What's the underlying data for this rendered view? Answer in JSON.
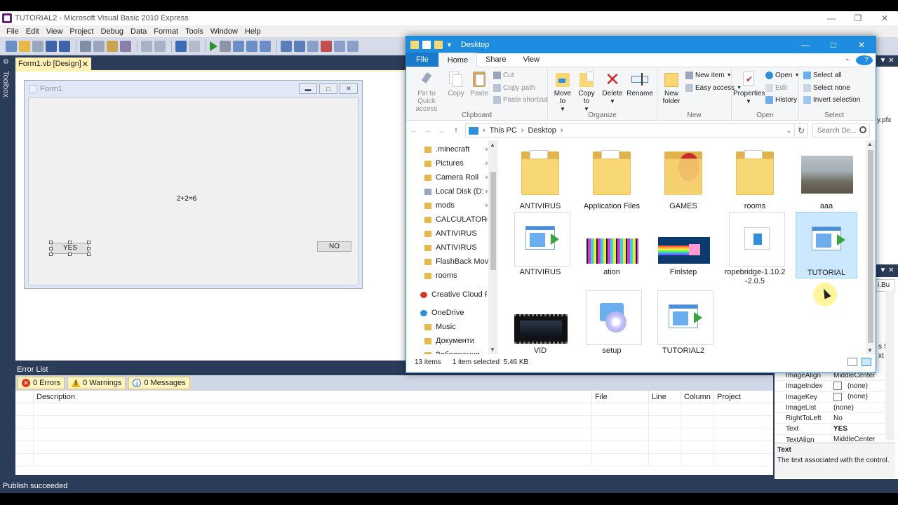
{
  "vs": {
    "title": "TUTORIAL2 - Microsoft Visual Basic 2010 Express",
    "menu": [
      "File",
      "Edit",
      "View",
      "Project",
      "Debug",
      "Data",
      "Format",
      "Tools",
      "Window",
      "Help"
    ],
    "toolbox_label": "Toolbox",
    "doc_tab": "Form1.vb [Design]",
    "form": {
      "title": "Form1",
      "label_text": "2+2=6",
      "yes_button": "YES",
      "no_button": "NO"
    },
    "error_list": {
      "title": "Error List",
      "errors": "0 Errors",
      "warnings": "0 Warnings",
      "messages": "0 Messages",
      "columns": [
        "Description",
        "File",
        "Line",
        "Column",
        "Project"
      ]
    },
    "status": "Publish succeeded",
    "right_panel": {
      "pfx_fragment": "y.pfx",
      "props_dropdown": "i.Bu",
      "stub_lines": [
        "s S",
        "xt"
      ],
      "properties": [
        {
          "key": "ImageAlign",
          "value": "MiddleCenter",
          "box": false,
          "bold": false
        },
        {
          "key": "ImageIndex",
          "value": "(none)",
          "box": true,
          "bold": false
        },
        {
          "key": "ImageKey",
          "value": "(none)",
          "box": true,
          "bold": false
        },
        {
          "key": "ImageList",
          "value": "(none)",
          "box": false,
          "bold": false
        },
        {
          "key": "RightToLeft",
          "value": "No",
          "box": false,
          "bold": false
        },
        {
          "key": "Text",
          "value": "YES",
          "box": false,
          "bold": true
        },
        {
          "key": "TextAlign",
          "value": "MiddleCenter",
          "box": false,
          "bold": false
        }
      ],
      "desc_title": "Text",
      "desc_text": "The text associated with the control."
    }
  },
  "explorer": {
    "title": "Desktop",
    "tabs": [
      "File",
      "Home",
      "Share",
      "View"
    ],
    "ribbon": {
      "clipboard": {
        "name": "Clipboard",
        "pin": "Pin to Quick access",
        "copy": "Copy",
        "paste": "Paste",
        "cut": "Cut",
        "copy_path": "Copy path",
        "paste_shortcut": "Paste shortcut"
      },
      "organize": {
        "name": "Organize",
        "move_to": "Move to",
        "copy_to": "Copy to",
        "delete": "Delete",
        "rename": "Rename"
      },
      "new": {
        "name": "New",
        "new_folder": "New folder",
        "new_item": "New item",
        "easy_access": "Easy access"
      },
      "open": {
        "name": "Open",
        "properties": "Properties",
        "open": "Open",
        "edit": "Edit",
        "history": "History"
      },
      "select": {
        "name": "Select",
        "select_all": "Select all",
        "select_none": "Select none",
        "invert": "Invert selection"
      }
    },
    "address": [
      "This PC",
      "Desktop"
    ],
    "search_placeholder": "Search De...",
    "nav": [
      {
        "label": ".minecraft",
        "pinned": true
      },
      {
        "label": "Pictures",
        "pinned": true
      },
      {
        "label": "Camera Roll",
        "pinned": true
      },
      {
        "label": "Local Disk (D:",
        "pinned": true
      },
      {
        "label": "mods",
        "pinned": true
      },
      {
        "label": "CALCULATOR",
        "pinned": true
      },
      {
        "label": "ANTIVIRUS",
        "pinned": false
      },
      {
        "label": "ANTIVIRUS",
        "pinned": false
      },
      {
        "label": "FlashBack Movie",
        "pinned": false
      },
      {
        "label": "rooms",
        "pinned": false
      },
      {
        "label": "Creative Cloud File",
        "pinned": false
      },
      {
        "label": "OneDrive",
        "pinned": false
      },
      {
        "label": "Music",
        "pinned": false
      },
      {
        "label": "Документи",
        "pinned": false
      },
      {
        "label": "Зображення",
        "pinned": false
      }
    ],
    "items": [
      {
        "label": "ANTIVIRUS",
        "kind": "folder"
      },
      {
        "label": "Application Files",
        "kind": "folder"
      },
      {
        "label": "GAMES",
        "kind": "folder"
      },
      {
        "label": "rooms",
        "kind": "folder"
      },
      {
        "label": "aaa",
        "kind": "photo"
      },
      {
        "label": "ANTIVIRUS",
        "kind": "exe"
      },
      {
        "label": "ation",
        "kind": "launchpad"
      },
      {
        "label": "Finlstep",
        "kind": "nyan"
      },
      {
        "label": "ropebridge-1.10.2-2.0.5",
        "kind": "doc"
      },
      {
        "label": "TUTORIAL",
        "kind": "exe"
      },
      {
        "label": "VID",
        "kind": "video"
      },
      {
        "label": "setup",
        "kind": "setup"
      },
      {
        "label": "TUTORIAL2",
        "kind": "exe"
      }
    ],
    "status": {
      "count": "13 items",
      "selected": "1 item selected",
      "size": "5.46 KB"
    }
  }
}
